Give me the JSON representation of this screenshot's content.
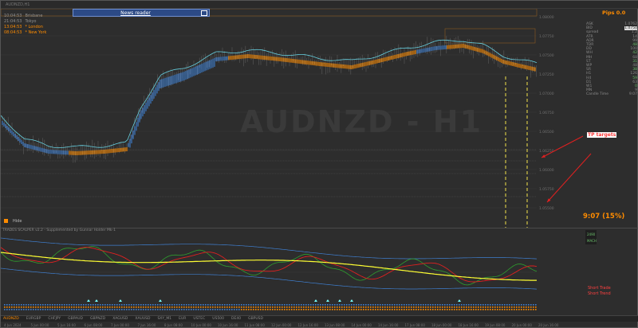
{
  "window": {
    "title": "AUDNZD,H1"
  },
  "sessions": [
    {
      "time": "10:04:53",
      "name": "Brisbane",
      "color": "#8f8f8f"
    },
    {
      "time": "21:04:53",
      "name": "Tokyo",
      "color": "#8f8f8f"
    },
    {
      "time": "13:04:53",
      "name": "* London",
      "color": "#ff8c00"
    },
    {
      "time": "08:04:53",
      "name": "* New York",
      "color": "#ff8c00"
    }
  ],
  "news": {
    "label": "News reader"
  },
  "watermark": "AUDNZD - H1",
  "info_panel": {
    "pips": "Pips 0.0",
    "rows": [
      [
        "ASK",
        "1.0762"
      ],
      [
        "BID",
        "1.0750"
      ],
      [
        "spread",
        "1.2"
      ],
      [
        "ATR",
        "14"
      ],
      [
        "ADR",
        "99"
      ],
      [
        "TDR",
        "48"
      ],
      [
        "DD",
        "100"
      ],
      [
        "WH",
        "42"
      ],
      [
        "MH",
        "68"
      ],
      [
        "ST",
        "31"
      ],
      [
        "WP",
        "48"
      ],
      [
        "SR",
        "38"
      ],
      [
        "H1",
        "126"
      ],
      [
        "H4",
        "59"
      ],
      [
        "D1",
        "63"
      ],
      [
        "W1",
        "0"
      ],
      [
        "MN",
        "9"
      ],
      [
        "Candle Time",
        "9:07"
      ]
    ]
  },
  "timer": "9:07 (15%)",
  "annotation": "TP targets",
  "hide_label": "Hide",
  "indicator_title": "TRADES SCALPER v2.2 - Supplemented by Gunnar Holder Mk-1",
  "legend_values": [
    "2490",
    "MACH"
  ],
  "signals": [
    "Short Trade",
    "Short Trend"
  ],
  "tabs": [
    "AUDNZD",
    "EURGBP",
    "CHFJPY",
    "GBPAUD",
    "GBPNZD",
    "XAGUSD",
    "XAUUSD",
    "SXY_M1",
    "EUR",
    "USTEC",
    "US500",
    "DE40",
    "GBPUSD"
  ],
  "time_axis": [
    "4 Jun 2024",
    "5 Jun 00:00",
    "5 Jun 16:00",
    "6 Jun 08:00",
    "7 Jun 00:00",
    "7 Jun 16:00",
    "8 Jun 08:00",
    "10 Jun 00:00",
    "10 Jun 16:00",
    "11 Jun 08:00",
    "12 Jun 00:00",
    "12 Jun 16:00",
    "13 Jun 08:00",
    "14 Jun 00:00",
    "14 Jun 16:00",
    "17 Jun 08:00",
    "18 Jun 00:00",
    "18 Jun 16:00",
    "19 Jun 08:00",
    "20 Jun 00:00",
    "20 Jun 16:00"
  ],
  "price_axis": [
    "1.08000",
    "1.07750",
    "1.07500",
    "1.07250",
    "1.07000",
    "1.06750",
    "1.06500",
    "1.06250",
    "1.06000",
    "1.05750",
    "1.05500"
  ],
  "colors": {
    "accent": "#ff8c00",
    "band_blue": "#3f7fd0",
    "trend_orange": "#ff8c00",
    "red": "#e02020",
    "green": "#2ea02e",
    "yellow": "#ffff33"
  }
}
